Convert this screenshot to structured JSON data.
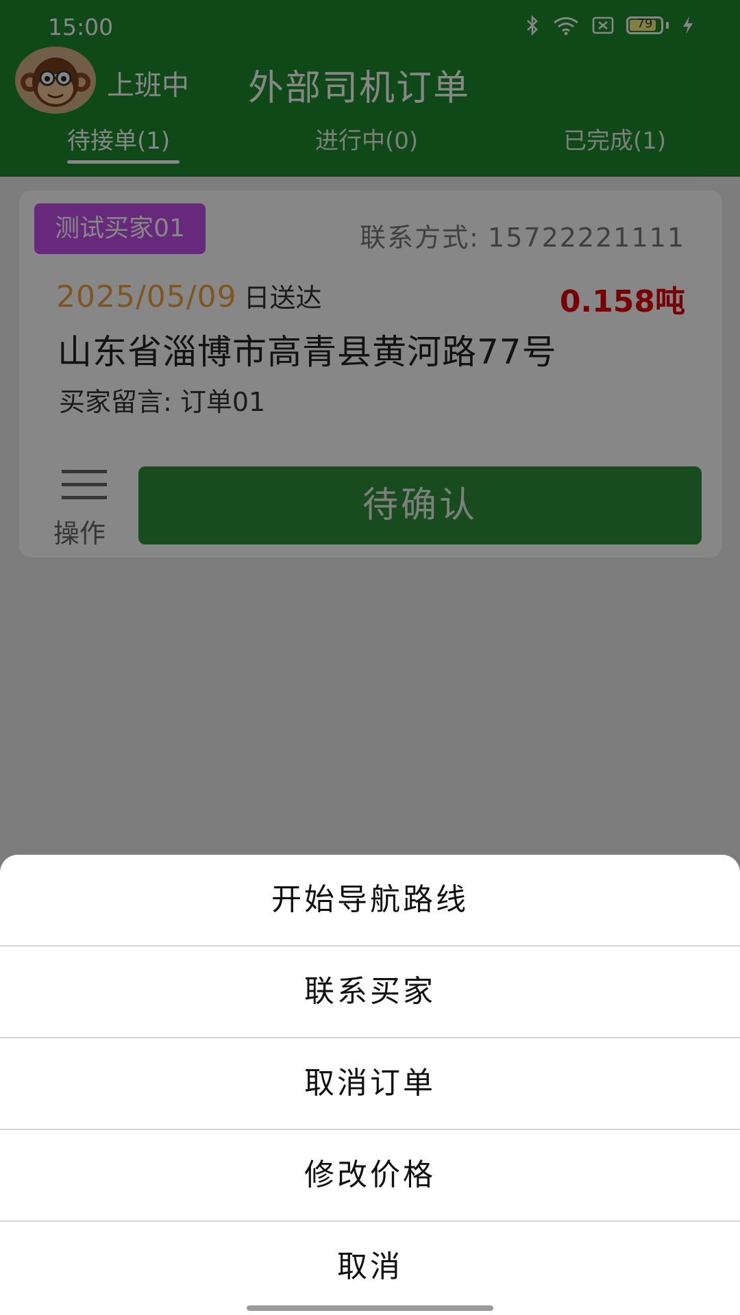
{
  "status_bar": {
    "time": "15:00",
    "battery_level": "79",
    "icons": [
      "bluetooth-icon",
      "wifi-icon",
      "sim-off-icon",
      "battery-icon",
      "charging-icon"
    ]
  },
  "header": {
    "work_status": "上班中",
    "title": "外部司机订单",
    "tabs": [
      {
        "label": "待接单(1)",
        "active": true
      },
      {
        "label": "进行中(0)",
        "active": false
      },
      {
        "label": "已完成(1)",
        "active": false
      }
    ]
  },
  "order": {
    "buyer": "测试买家01",
    "contact_label": "联系方式:",
    "contact_phone": "15722221111",
    "date": "2025/05/09",
    "date_suffix": "日送达",
    "weight": "0.158吨",
    "address": "山东省淄博市高青县黄河路77号",
    "note": "买家留言: 订单01",
    "ops_label": "操作",
    "action_label": "待确认"
  },
  "action_sheet": {
    "items": [
      "开始导航路线",
      "联系买家",
      "取消订单",
      "修改价格",
      "取消"
    ]
  },
  "colors": {
    "header_green": "#1e8a2c",
    "badge_purple": "#c04fea",
    "date_orange": "#f0a23c",
    "weight_red": "#e0000a"
  }
}
